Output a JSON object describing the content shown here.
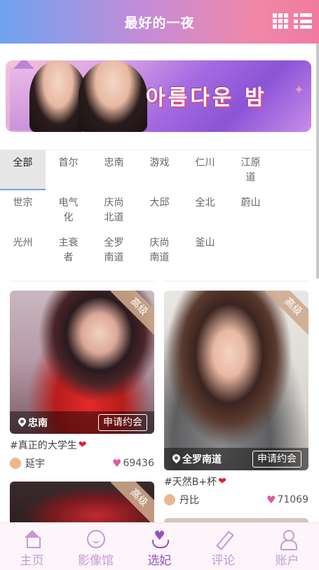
{
  "header": {
    "title": "最好的一夜",
    "grid_icon": "grid-view-icon",
    "list_icon": "list-view-icon"
  },
  "banner": {
    "text": "아름다운 밤"
  },
  "regions": [
    {
      "label": "全部",
      "active": true
    },
    {
      "label": "首尔"
    },
    {
      "label": "忠南"
    },
    {
      "label": "游戏"
    },
    {
      "label": "仁川"
    },
    {
      "label": "江原道"
    },
    {
      "label": "世宗"
    },
    {
      "label": "电气化"
    },
    {
      "label": "庆尚北道"
    },
    {
      "label": "大邱"
    },
    {
      "label": "全北"
    },
    {
      "label": "蔚山"
    },
    {
      "label": "光州"
    },
    {
      "label": "主衰者"
    },
    {
      "label": "全罗南道"
    },
    {
      "label": "庆尚南道"
    },
    {
      "label": "釜山"
    }
  ],
  "cards": [
    {
      "badge": "高级",
      "location": "忠南",
      "apply_label": "申请约会",
      "tag": "#真正的大学生",
      "user": "延宇",
      "likes": "69436"
    },
    {
      "badge": "高级",
      "location": "全罗南道",
      "apply_label": "申请约会",
      "tag": "#天然B+杯",
      "user": "丹比",
      "likes": "71069"
    },
    {
      "badge": "高级"
    }
  ],
  "bottom_nav": [
    {
      "label": "主页",
      "icon": "home-icon"
    },
    {
      "label": "影像馆",
      "icon": "smile-icon"
    },
    {
      "label": "选妃",
      "icon": "heart-hand-icon",
      "active": true
    },
    {
      "label": "评论",
      "icon": "pencil-icon"
    },
    {
      "label": "账户",
      "icon": "user-icon"
    }
  ],
  "colors": {
    "accent": "#9b4fbd",
    "nav_inactive": "#c698d8",
    "heart": "#e05aa0"
  }
}
